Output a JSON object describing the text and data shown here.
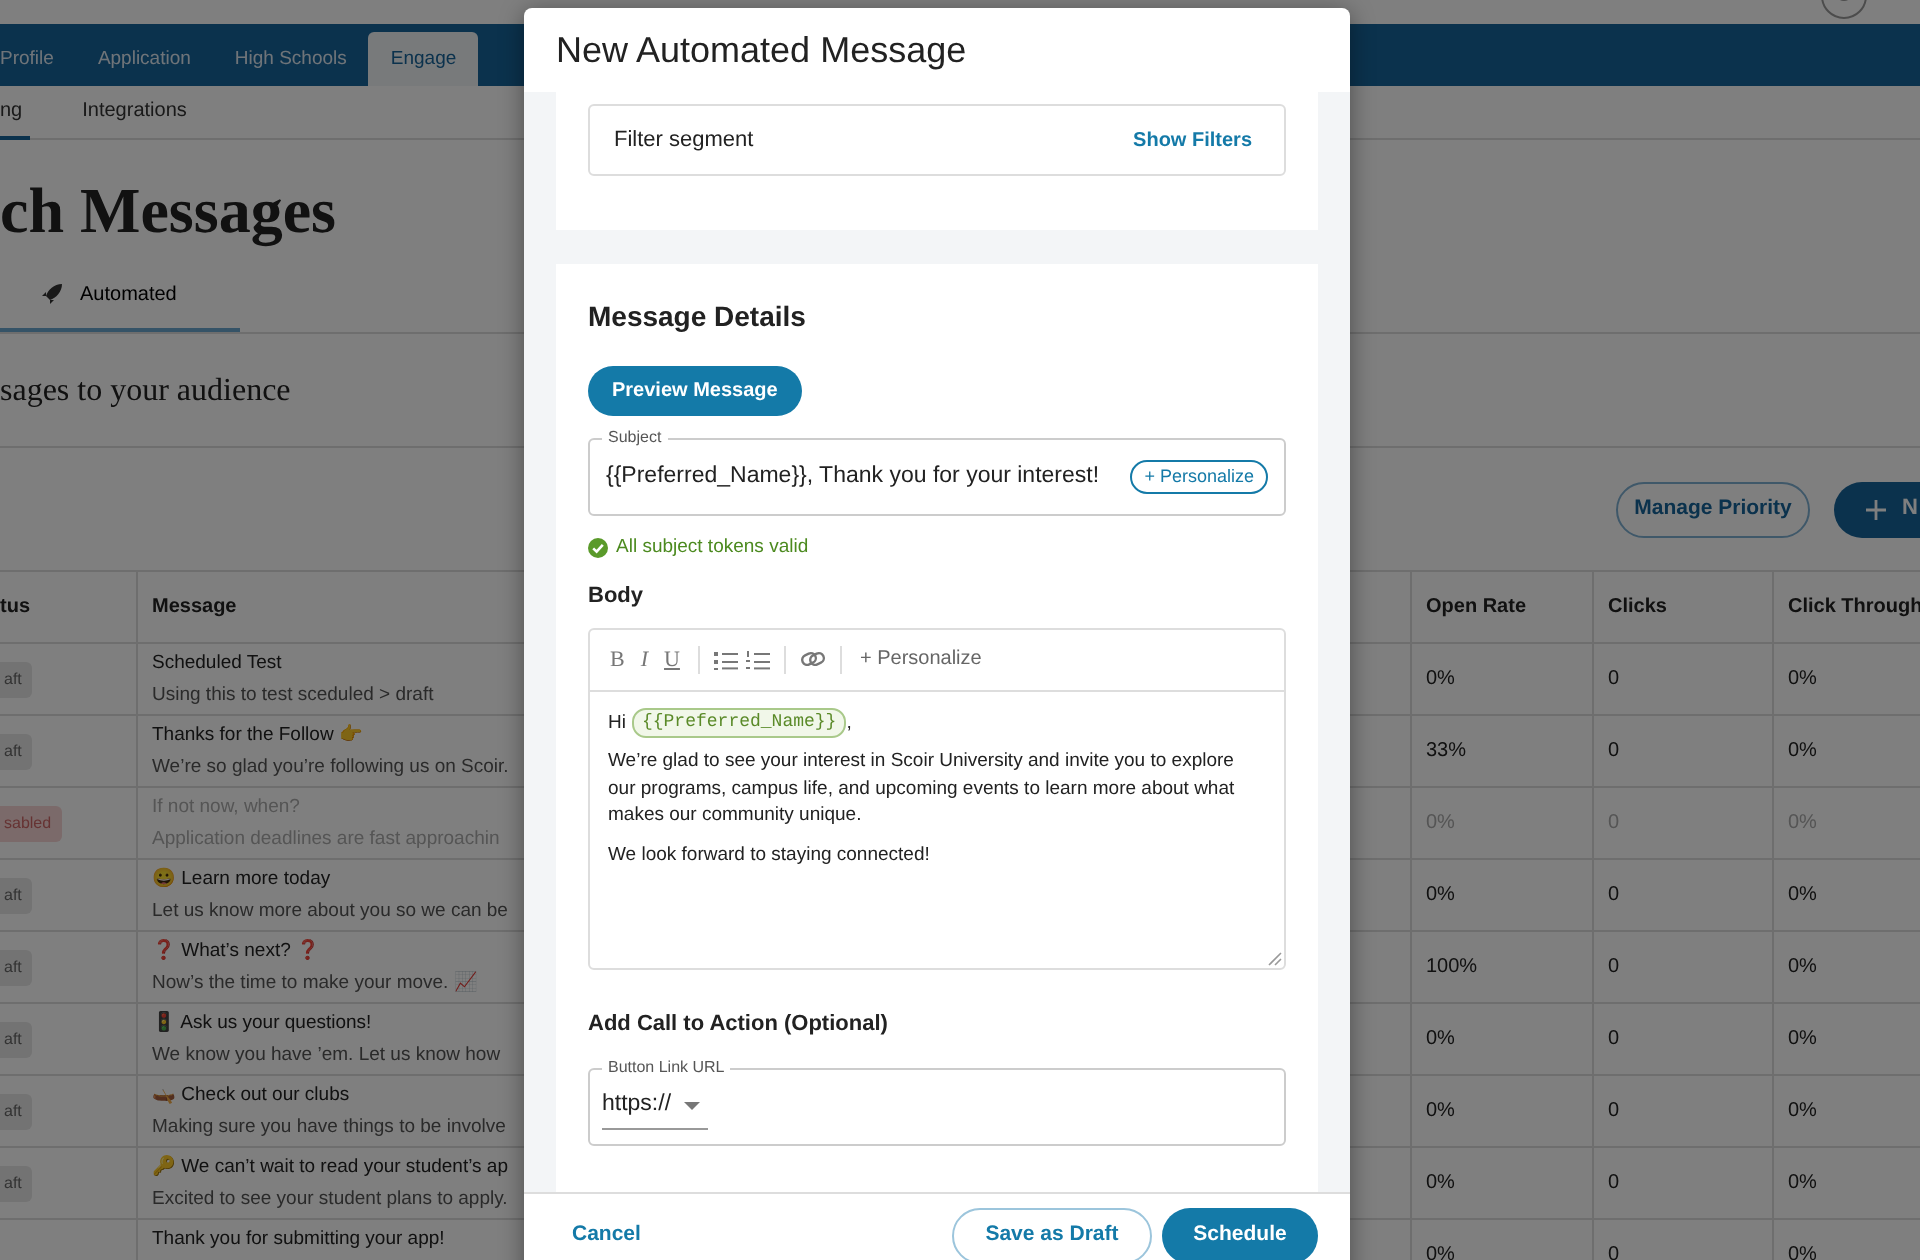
{
  "page": {
    "nav_tabs": [
      {
        "label": "Profile",
        "selected": false
      },
      {
        "label": "Application",
        "selected": false
      },
      {
        "label": "High Schools",
        "selected": false
      },
      {
        "label": "Engage",
        "selected": true
      }
    ],
    "sub_tabs": [
      {
        "label": "ng",
        "selected": true
      },
      {
        "label": "Integrations",
        "selected": false
      }
    ],
    "title": "ch Messages",
    "message_tabs": [
      {
        "label": "Automated",
        "selected": true
      }
    ],
    "subtitle": "sages to your audience",
    "buttons": [
      {
        "label": "Manage Priority",
        "kind": "outline"
      },
      {
        "label": "N",
        "kind": "new"
      }
    ],
    "table": {
      "columns": [
        "tus",
        "Message",
        "Open Rate",
        "Clicks",
        "Click Through"
      ],
      "rows": [
        {
          "status": "aft",
          "title": "Scheduled Test",
          "subtitle": "Using this to test sceduled > draft",
          "open_rate": "0%",
          "clicks": "0",
          "click_through": "0%",
          "disabled": false
        },
        {
          "status": "aft",
          "title": "Thanks for the Follow 👉",
          "subtitle": "We’re so glad you’re following us on Scoir.",
          "open_rate": "33%",
          "clicks": "0",
          "click_through": "0%",
          "disabled": false
        },
        {
          "status": "sabled",
          "title": "If not now, when?",
          "subtitle": "Application deadlines are fast approachin",
          "open_rate": "0%",
          "clicks": "0",
          "click_through": "0%",
          "disabled": true
        },
        {
          "status": "aft",
          "title": "😀 Learn more today",
          "subtitle": "Let us know more about you so we can be",
          "open_rate": "0%",
          "clicks": "0",
          "click_through": "0%",
          "disabled": false
        },
        {
          "status": "aft",
          "title": "❓ What’s next? ❓",
          "subtitle": "Now’s the time to make your move. 📈",
          "open_rate": "100%",
          "clicks": "0",
          "click_through": "0%",
          "disabled": false
        },
        {
          "status": "aft",
          "title": "🚦 Ask us your questions!",
          "subtitle": "We know you have ’em. Let us know how",
          "open_rate": "0%",
          "clicks": "0",
          "click_through": "0%",
          "disabled": false
        },
        {
          "status": "aft",
          "title": "🛶 Check out our clubs",
          "subtitle": "Making sure you have things to be involve",
          "open_rate": "0%",
          "clicks": "0",
          "click_through": "0%",
          "disabled": false
        },
        {
          "status": "aft",
          "title": "🔑 We can’t wait to read your student’s ap",
          "subtitle": "Excited to see your student plans to apply.",
          "open_rate": "0%",
          "clicks": "0",
          "click_through": "0%",
          "disabled": false
        },
        {
          "title": "Thank you for submitting your app!",
          "open_rate": "0%",
          "clicks": "0",
          "click_through": "0%",
          "disabled": false
        }
      ]
    }
  },
  "modal": {
    "title": "New Automated Message",
    "filter": {
      "label": "Filter segment",
      "action": "Show Filters"
    },
    "details": {
      "heading": "Message Details",
      "preview_button": "Preview Message",
      "subject": {
        "label": "Subject",
        "value": "{{Preferred_Name}}, Thank you for your interest!",
        "personalize": "+ Personalize"
      },
      "validation": "All subject tokens valid",
      "body_label": "Body",
      "editor": {
        "toolbar": [
          {
            "kind": "bold",
            "label": "B"
          },
          {
            "kind": "italic",
            "label": "I"
          },
          {
            "kind": "underline",
            "label": "U"
          },
          {
            "kind": "bullets"
          },
          {
            "kind": "numbers"
          },
          {
            "kind": "link"
          }
        ],
        "personalize": "+ Personalize",
        "greeting": "Hi",
        "token": "{{Preferred_Name}}",
        "greeting_end": ",",
        "paragraphs": [
          "We’re glad to see your interest in Scoir University and invite you to explore our programs, campus life, and upcoming events to learn more about what makes our community unique.",
          "We look forward to staying connected!"
        ]
      },
      "cta_heading": "Add Call to Action (Optional)",
      "url": {
        "label": "Button Link URL",
        "protocol": "https://"
      }
    },
    "footer": {
      "cancel": "Cancel",
      "draft": "Save as Draft",
      "schedule": "Schedule"
    }
  }
}
